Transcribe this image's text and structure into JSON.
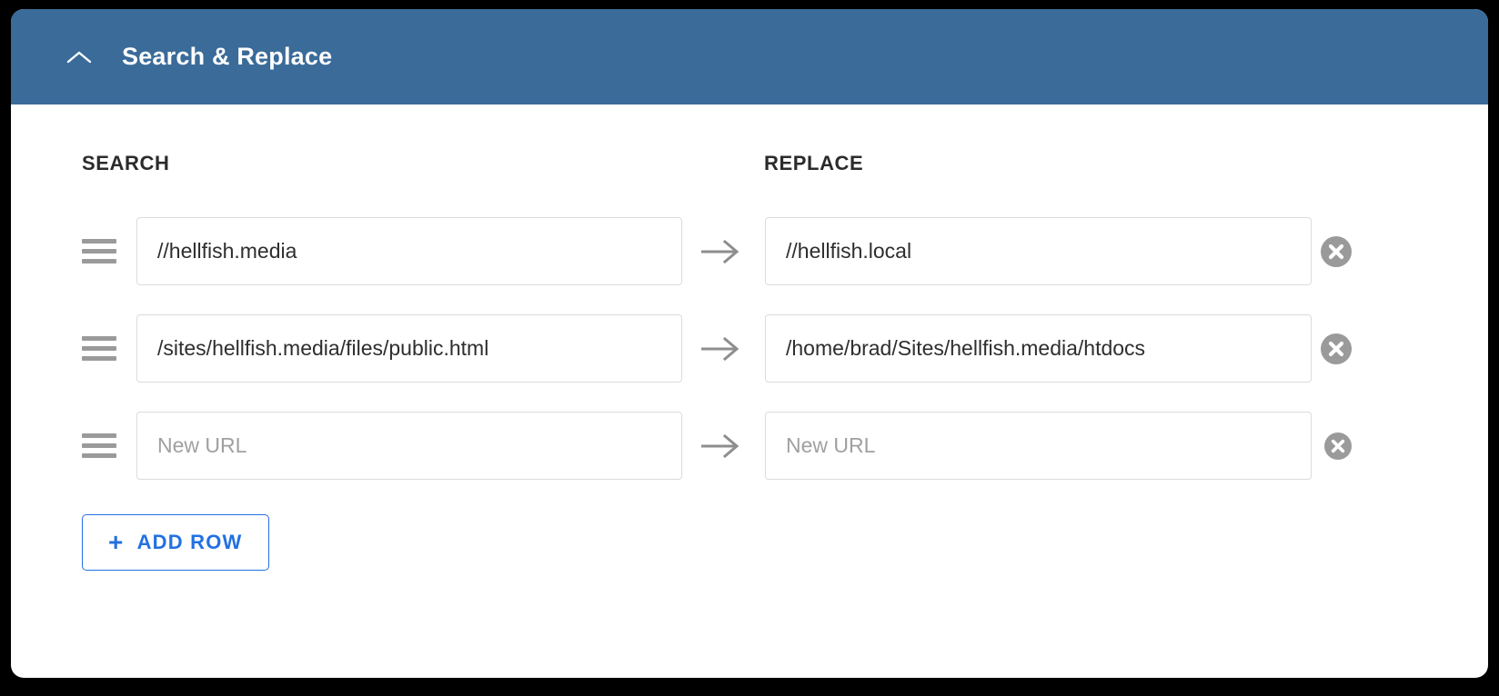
{
  "header": {
    "title": "Search & Replace",
    "toggle_icon": "chevron-up-icon",
    "background_color": "#3a6b99",
    "text_color": "#ffffff"
  },
  "columns": {
    "search_label": "SEARCH",
    "replace_label": "REPLACE"
  },
  "icons": {
    "drag_handle": "drag-handle-icon",
    "arrow": "arrow-right-icon",
    "remove": "remove-circle-icon",
    "plus": "+"
  },
  "rows": [
    {
      "search_value": "//hellfish.media",
      "search_placeholder": "New URL",
      "replace_value": "//hellfish.local",
      "replace_placeholder": "New URL"
    },
    {
      "search_value": "/sites/hellfish.media/files/public.html",
      "search_placeholder": "New URL",
      "replace_value": "/home/brad/Sites/hellfish.media/htdocs",
      "replace_placeholder": "New URL"
    },
    {
      "search_value": "",
      "search_placeholder": "New URL",
      "replace_value": "",
      "replace_placeholder": "New URL"
    }
  ],
  "add_row": {
    "label": "ADD ROW",
    "accent_color": "#2271e0"
  }
}
